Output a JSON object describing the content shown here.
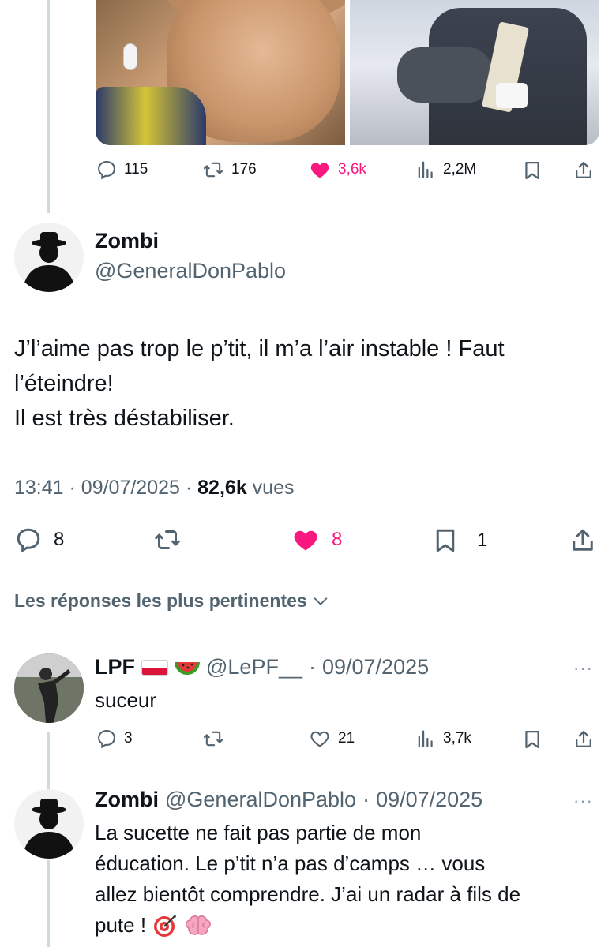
{
  "colors": {
    "pink": "#f91880",
    "gray": "#536471",
    "text": "#0f1419",
    "line": "#cfd9de"
  },
  "top_tweet": {
    "media": [
      {
        "icon": "photo-young-man-with-earbud"
      },
      {
        "icon": "photo-person-holding-paper"
      }
    ],
    "stats": {
      "replies": "115",
      "reposts": "176",
      "likes": "3,6k",
      "views": "2,2M"
    }
  },
  "main_tweet": {
    "name": "Zombi",
    "handle": "@GeneralDonPablo",
    "text_lines": [
      "J’l’aime pas trop le p’tit, il m’a l’air instable ! Faut",
      "l’éteindre!",
      "Il est très déstabiliser."
    ],
    "time": "13:41",
    "date": "09/07/2025",
    "views_count": "82,6k",
    "views_label": "vues",
    "stats": {
      "replies": "8",
      "likes": "8",
      "bookmarks": "1"
    }
  },
  "sort_label": "Les réponses les plus pertinentes",
  "replies": [
    {
      "name": "LPF",
      "handle": "@LePF__",
      "date": "09/07/2025",
      "text_lines": [
        "suceur"
      ],
      "stats": {
        "replies": "3",
        "likes": "21",
        "views": "3,7k"
      }
    },
    {
      "name": "Zombi",
      "handle": "@GeneralDonPablo",
      "date": "09/07/2025",
      "text_lines": [
        "La sucette ne fait pas partie de mon",
        "éducation. Le p’tit n’a pas d’camps … vous",
        "allez bientôt comprendre. J’ai un radar à fils de",
        "pute !"
      ]
    }
  ],
  "separator": "·",
  "more_label": "···"
}
